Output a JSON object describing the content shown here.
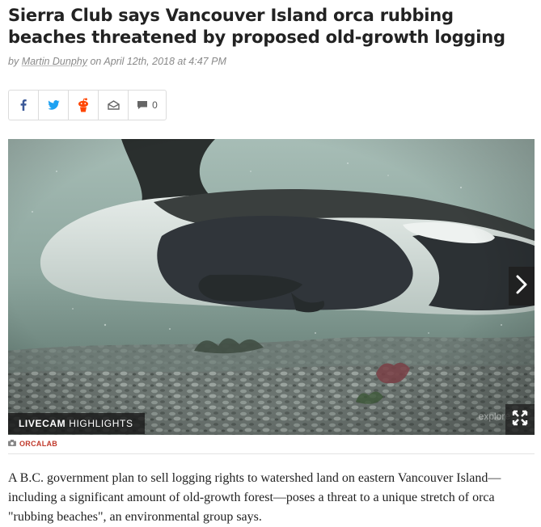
{
  "article": {
    "headline": "Sierra Club says Vancouver Island orca rubbing beaches threatened by proposed old-growth logging",
    "byline_prefix": "by ",
    "author": "Martin Dunphy",
    "date_text": " on April 12th, 2018 at 4:47 PM",
    "body": "A B.C. government plan to sell logging rights to watershed land on eastern Vancouver Island—including a significant amount of old-growth forest—poses a threat to a unique stretch of orca \"rubbing beaches\", an environmental group says."
  },
  "share": {
    "buttons": [
      {
        "name": "facebook",
        "icon": "facebook-icon",
        "color": "#3b5998"
      },
      {
        "name": "twitter",
        "icon": "twitter-icon",
        "color": "#1da1f2"
      },
      {
        "name": "reddit",
        "icon": "reddit-icon",
        "color": "#ff4500"
      },
      {
        "name": "email",
        "icon": "envelope-icon",
        "color": "#666666"
      },
      {
        "name": "comments",
        "icon": "comment-icon",
        "color": "#666666"
      }
    ],
    "comment_count": "0"
  },
  "media": {
    "overlay_bold": "LIVECAM",
    "overlay_rest": "HIGHLIGHTS",
    "watermark": "explore",
    "credit": "ORCALAB",
    "next_icon": "chevron-right-icon",
    "expand_icon": "expand-icon"
  },
  "colors": {
    "credit": "#c0392b",
    "water": "#8fa79e"
  }
}
